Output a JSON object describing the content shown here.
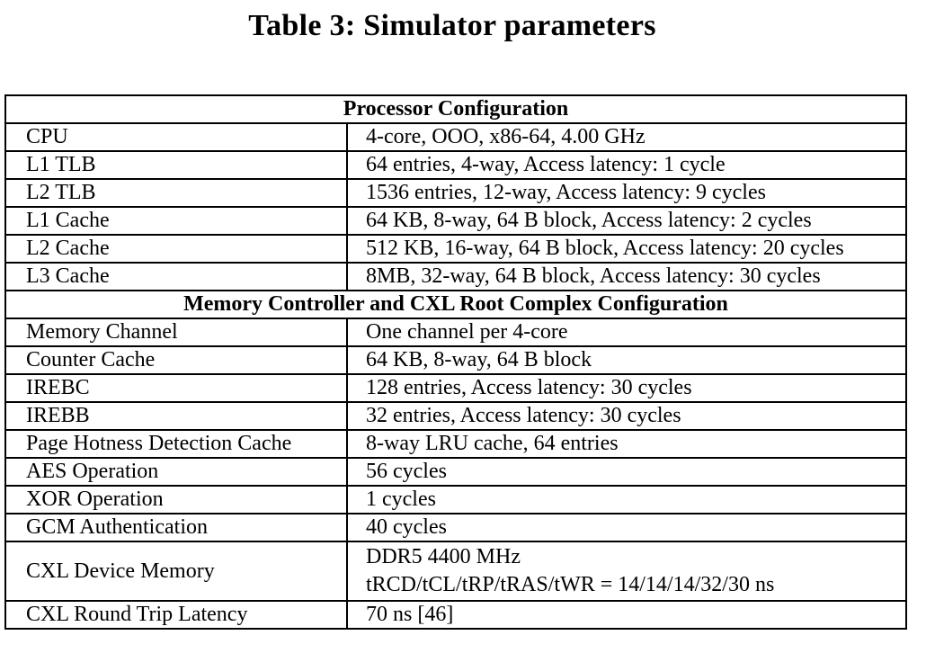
{
  "caption": "Table 3: Simulator parameters",
  "sections": [
    {
      "heading": "Processor Configuration",
      "rows": [
        {
          "param": "CPU",
          "value": [
            "4-core, OOO, x86-64, 4.00 GHz"
          ]
        },
        {
          "param": "L1 TLB",
          "value": [
            "64 entries, 4-way, Access latency: 1 cycle"
          ]
        },
        {
          "param": "L2 TLB",
          "value": [
            "1536 entries, 12-way, Access latency: 9 cycles"
          ]
        },
        {
          "param": "L1 Cache",
          "value": [
            "64 KB, 8-way, 64 B block, Access latency: 2 cycles"
          ]
        },
        {
          "param": "L2 Cache",
          "value": [
            "512 KB, 16-way, 64 B block, Access latency: 20 cycles"
          ]
        },
        {
          "param": "L3 Cache",
          "value": [
            "8MB, 32-way, 64 B block, Access latency: 30 cycles"
          ]
        }
      ]
    },
    {
      "heading": "Memory Controller and CXL Root Complex Configuration",
      "rows": [
        {
          "param": "Memory Channel",
          "value": [
            "One channel per 4-core"
          ]
        },
        {
          "param": "Counter Cache",
          "value": [
            "64 KB, 8-way, 64 B block"
          ]
        },
        {
          "param": "IREBC",
          "value": [
            "128 entries, Access latency: 30 cycles"
          ]
        },
        {
          "param": "IREBB",
          "value": [
            "32 entries, Access latency: 30 cycles"
          ]
        },
        {
          "param": "Page Hotness Detection Cache",
          "value": [
            "8-way LRU cache, 64 entries"
          ]
        },
        {
          "param": "AES Operation",
          "value": [
            "56 cycles"
          ]
        },
        {
          "param": "XOR Operation",
          "value": [
            "1 cycles"
          ]
        },
        {
          "param": "GCM Authentication",
          "value": [
            "40 cycles"
          ]
        },
        {
          "param": "CXL Device Memory",
          "value": [
            "DDR5 4400 MHz",
            "tRCD/tCL/tRP/tRAS/tWR = 14/14/14/32/30 ns"
          ]
        },
        {
          "param": "CXL Round Trip Latency",
          "value": [
            "70 ns [46]"
          ]
        }
      ]
    }
  ]
}
